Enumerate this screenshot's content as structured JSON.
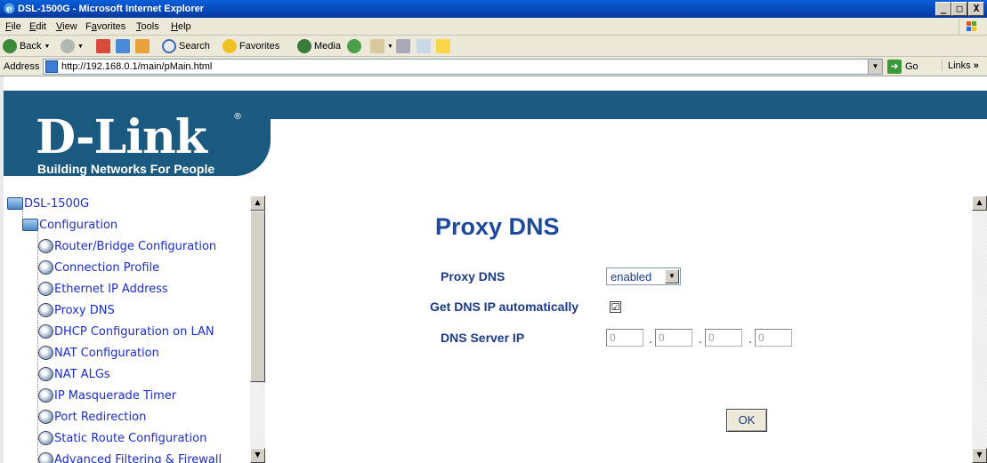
{
  "window": {
    "title": "DSL-1500G - Microsoft Internet Explorer",
    "controls": [
      "_",
      "□",
      "X"
    ]
  },
  "menu": {
    "items": [
      {
        "pre": "",
        "ul": "F",
        "post": "ile"
      },
      {
        "pre": "",
        "ul": "E",
        "post": "dit"
      },
      {
        "pre": "",
        "ul": "V",
        "post": "iew"
      },
      {
        "pre": "F",
        "ul": "a",
        "post": "vorites"
      },
      {
        "pre": "",
        "ul": "T",
        "post": "ools"
      },
      {
        "pre": "",
        "ul": "H",
        "post": "elp"
      }
    ]
  },
  "toolbar": {
    "back_label": "Back",
    "search_label": "Search",
    "favorites_label": "Favorites",
    "media_label": "Media"
  },
  "address": {
    "label": "Address",
    "url": "http://192.168.0.1/main/pMain.html",
    "go_label": "Go",
    "links_label": "Links"
  },
  "banner": {
    "logo": "D-Link",
    "registered": "®",
    "tagline": "Building Networks For People"
  },
  "tree": {
    "root": "DSL-1500G",
    "folder": "Configuration",
    "items": [
      "Router/Bridge Configuration",
      "Connection Profile",
      "Ethernet IP Address",
      "Proxy DNS",
      "DHCP Configuration on LAN",
      "NAT Configuration",
      "NAT ALGs",
      "IP Masquerade Timer",
      "Port Redirection",
      "Static Route Configuration",
      "Advanced Filtering & Firewall"
    ]
  },
  "form": {
    "title": "Proxy DNS",
    "proxy_dns_label": "Proxy DNS",
    "proxy_dns_value": "enabled",
    "get_dns_label": "Get DNS IP automatically",
    "get_dns_checked": "☑",
    "dns_server_label": "DNS Server IP",
    "dns_ip": [
      "0",
      "0",
      "0",
      "0"
    ],
    "dot": ".",
    "ok_label": "OK"
  },
  "colors": {
    "brand_blue": "#1b5a80",
    "heading_blue": "#1b4a9c",
    "tree_link": "#1a2bd0"
  }
}
